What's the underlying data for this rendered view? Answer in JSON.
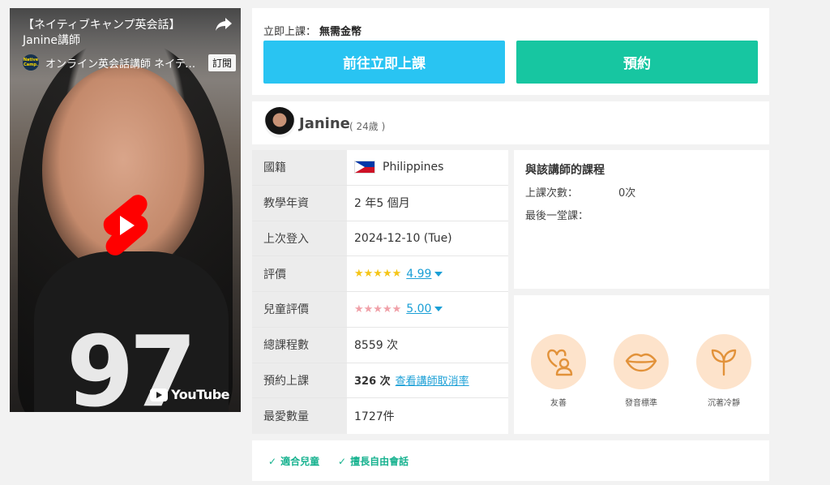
{
  "video": {
    "title": "【ネイティブキャンプ英会話】\nJanine講師",
    "channel_logo_text": "Native Camp.",
    "channel_name": "オンライン英会話講師 ネイティ…",
    "subscribe_label": "訂閱",
    "youtube_label": "YouTube",
    "shirt_number": "97"
  },
  "booking": {
    "label": "立即上課：",
    "value": "無需金幣",
    "start_now_label": "前往立即上課",
    "reserve_label": "預約"
  },
  "teacher": {
    "name": "Janine",
    "age": "( 24歲 )"
  },
  "info": {
    "nationality_key": "國籍",
    "nationality_val": "Philippines",
    "experience_key": "教學年資",
    "experience_val": "2 年5 個月",
    "last_login_key": "上次登入",
    "last_login_val": "2024-12-10 (Tue)",
    "rating_key": "評價",
    "rating_stars": "★★★★★",
    "rating_val": "4.99",
    "kids_rating_key": "兒童評價",
    "kids_rating_stars": "★★★★★",
    "kids_rating_val": "5.00",
    "total_lessons_key": "總課程數",
    "total_lessons_val": "8559 次",
    "reserved_key": "預約上課",
    "reserved_val": "326 次",
    "cancel_rate_link": "查看講師取消率",
    "favorites_key": "最愛數量",
    "favorites_val": "1727件"
  },
  "course": {
    "title": "與該講師的課程",
    "count_label": "上課次數：",
    "count_val": "0次",
    "last_label": "最後一堂課："
  },
  "traits": [
    {
      "label": "友善",
      "icon": "friendly-person-icon"
    },
    {
      "label": "發音標準",
      "icon": "lips-icon"
    },
    {
      "label": "沉著冷靜",
      "icon": "sprout-icon"
    }
  ],
  "tags": [
    "適合兒童",
    "擅長自由會話"
  ],
  "colors": {
    "start_now": "#29c4f2",
    "reserve": "#17c6a1",
    "link": "#1a9fd6",
    "trait_bg": "#fde3cb",
    "trait_icon": "#e2923a",
    "tag": "#17b28f"
  }
}
